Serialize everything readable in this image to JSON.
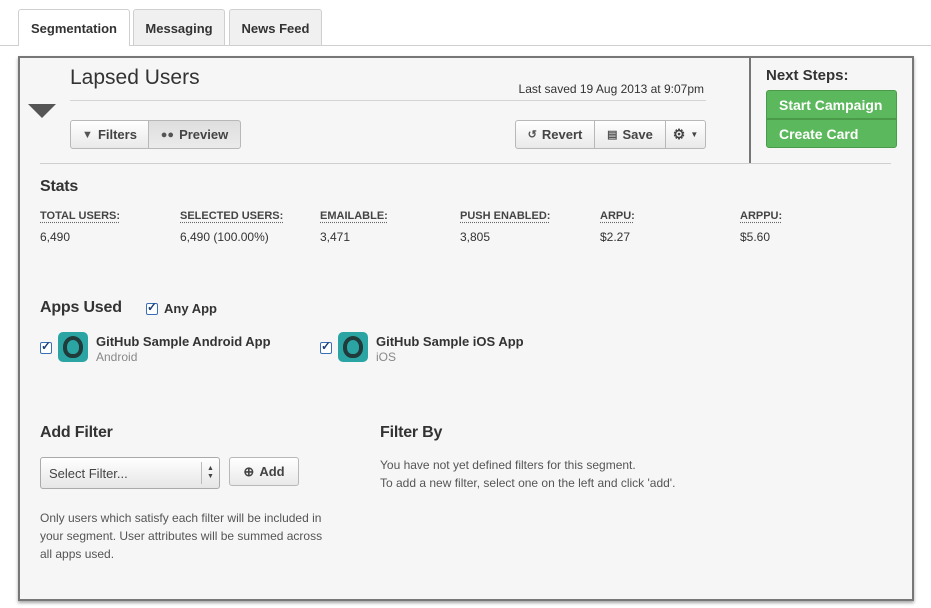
{
  "tabs": [
    {
      "label": "Segmentation",
      "active": true
    },
    {
      "label": "Messaging",
      "active": false
    },
    {
      "label": "News Feed",
      "active": false
    }
  ],
  "segment": {
    "title": "Lapsed Users",
    "last_saved": "Last saved 19 Aug 2013 at 9:07pm"
  },
  "toolbar": {
    "filters_label": "Filters",
    "preview_label": "Preview",
    "revert_label": "Revert",
    "save_label": "Save"
  },
  "next_steps": {
    "title": "Next Steps:",
    "start_campaign": "Start Campaign",
    "create_card": "Create Card"
  },
  "stats": {
    "heading": "Stats",
    "items": [
      {
        "label": "TOTAL USERS:",
        "value": "6,490"
      },
      {
        "label": "SELECTED USERS:",
        "value": "6,490 (100.00%)"
      },
      {
        "label": "EMAILABLE:",
        "value": "3,471"
      },
      {
        "label": "PUSH ENABLED:",
        "value": "3,805"
      },
      {
        "label": "ARPU:",
        "value": "$2.27"
      },
      {
        "label": "ARPPU:",
        "value": "$5.60"
      }
    ]
  },
  "apps": {
    "heading": "Apps Used",
    "any_app_label": "Any App",
    "items": [
      {
        "name": "GitHub Sample Android App",
        "platform": "Android",
        "checked": true
      },
      {
        "name": "GitHub Sample iOS App",
        "platform": "iOS",
        "checked": true
      }
    ]
  },
  "add_filter": {
    "heading": "Add Filter",
    "select_placeholder": "Select Filter...",
    "add_label": "Add",
    "help": "Only users which satisfy each filter will be included in your segment. User attributes will be summed across all apps used."
  },
  "filter_by": {
    "heading": "Filter By",
    "line1": "You have not yet defined filters for this segment.",
    "line2": "To add a new filter, select one on the left and click 'add'."
  },
  "colors": {
    "green": "#5cb85c",
    "app_icon": "#2ba4a4",
    "checkbox": "#3a6fb5"
  }
}
